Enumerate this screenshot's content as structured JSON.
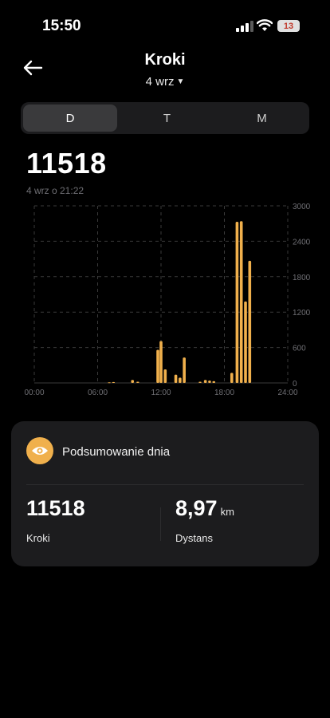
{
  "status": {
    "time": "15:50",
    "battery": "13"
  },
  "header": {
    "title": "Kroki",
    "date": "4 wrz"
  },
  "tabs": [
    "D",
    "T",
    "M"
  ],
  "summary": {
    "value": "11518",
    "timestamp": "4 wrz o 21:22"
  },
  "chart_data": {
    "type": "bar",
    "title": "",
    "xlabel": "",
    "ylabel": "",
    "x_ticks": [
      "00:00",
      "06:00",
      "12:00",
      "18:00",
      "24:00"
    ],
    "y_ticks": [
      "0",
      "600",
      "1200",
      "1800",
      "2400",
      "3000"
    ],
    "ylim": [
      0,
      3000
    ],
    "xlim": [
      0,
      24
    ],
    "grid": true,
    "bar_color": "#f0b04c",
    "x": [
      7.1,
      7.5,
      9.3,
      9.8,
      11.7,
      12.0,
      12.4,
      13.4,
      13.8,
      14.2,
      15.7,
      16.2,
      16.6,
      17.0,
      18.7,
      19.2,
      19.6,
      20.0,
      20.4
    ],
    "values": [
      10,
      15,
      50,
      20,
      560,
      710,
      230,
      140,
      90,
      430,
      20,
      50,
      40,
      30,
      170,
      2730,
      2740,
      1380,
      2070
    ]
  },
  "card": {
    "title": "Podsumowanie dnia",
    "steps_value": "11518",
    "steps_label": "Kroki",
    "distance_value": "8,97",
    "distance_unit": "km",
    "distance_label": "Dystans"
  },
  "colors": {
    "accent": "#f0b04c",
    "card_bg": "#1c1c1e",
    "background": "#000000"
  }
}
